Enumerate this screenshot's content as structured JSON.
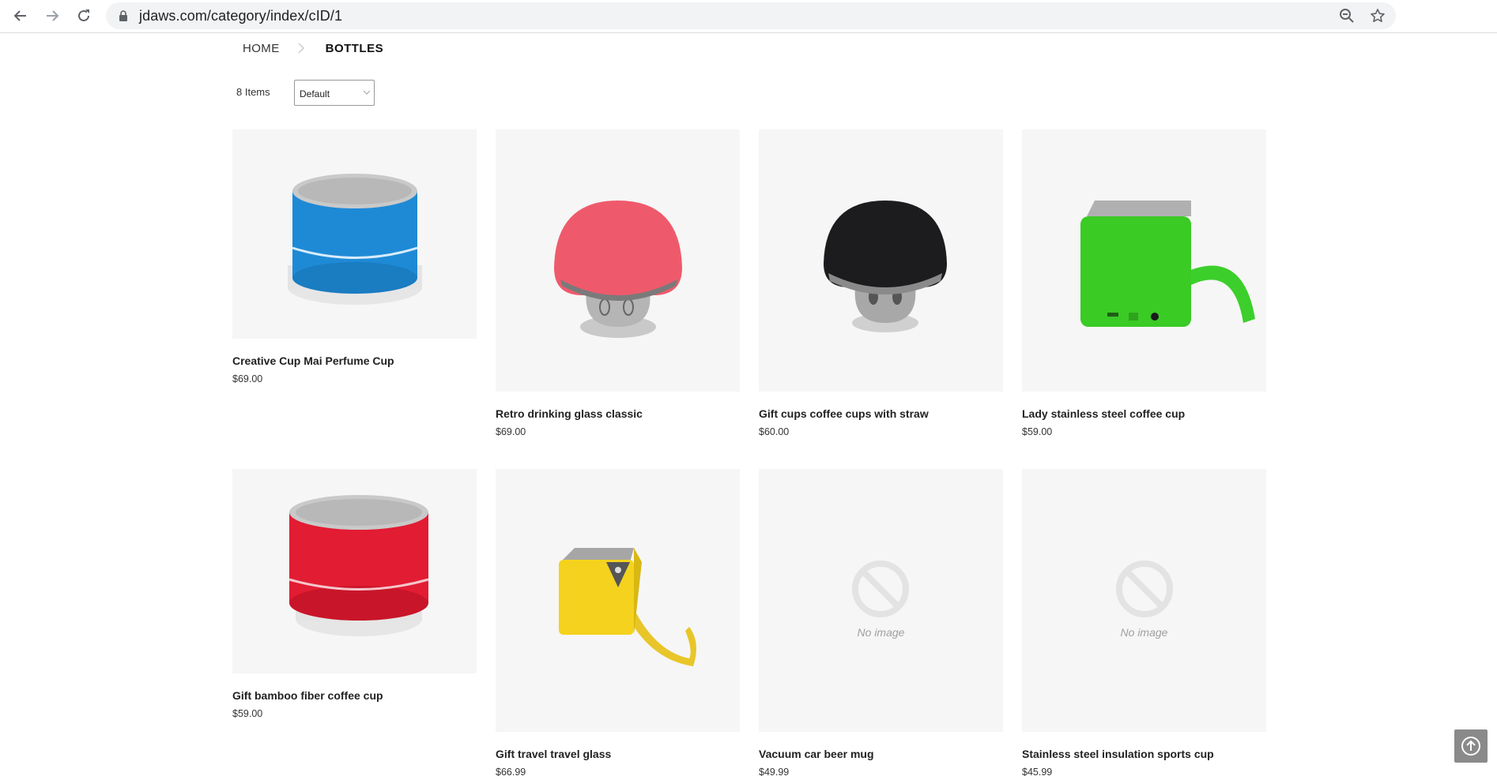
{
  "browser": {
    "url": "jdaws.com/category/index/cID/1"
  },
  "breadcrumb": {
    "home": "HOME",
    "current": "BOTTLES"
  },
  "toolbar": {
    "items_count": "8 Items",
    "sort_selected": "Default"
  },
  "products": [
    {
      "name": "Creative Cup Mai Perfume Cup",
      "price": "$69.00",
      "image": "blue-round-speaker"
    },
    {
      "name": "Retro drinking glass classic",
      "price": "$69.00",
      "image": "red-mushroom-speaker"
    },
    {
      "name": "Gift cups coffee cups with straw",
      "price": "$60.00",
      "image": "black-mushroom-speaker"
    },
    {
      "name": "Lady stainless steel coffee cup",
      "price": "$59.00",
      "image": "green-cube-speaker"
    },
    {
      "name": "Gift bamboo fiber coffee cup",
      "price": "$59.00",
      "image": "red-round-speaker"
    },
    {
      "name": "Gift travel travel glass",
      "price": "$66.99",
      "image": "yellow-cube-speaker"
    },
    {
      "name": "Vacuum car beer mug",
      "price": "$49.99",
      "image": "no-image",
      "placeholder": "No image"
    },
    {
      "name": "Stainless steel insulation sports cup",
      "price": "$45.99",
      "image": "no-image",
      "placeholder": "No image"
    }
  ]
}
